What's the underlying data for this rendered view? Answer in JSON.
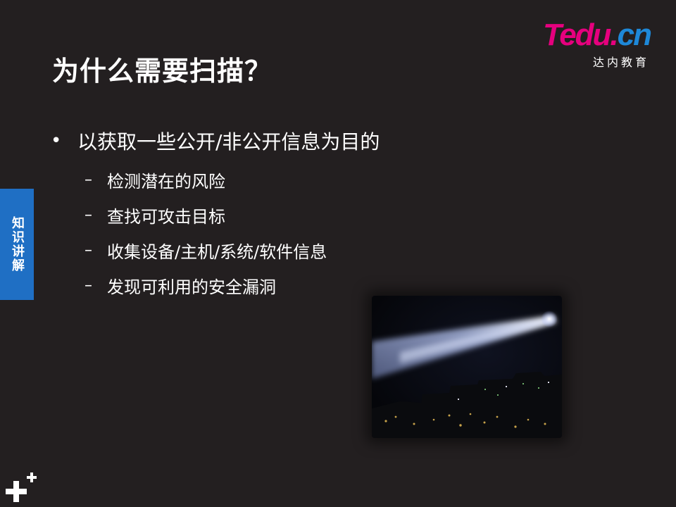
{
  "logo": {
    "brand_t": "T",
    "brand_rest": "edu.",
    "brand_cn": "cn",
    "subtitle": "达内教育",
    "colors": {
      "magenta": "#e6007e",
      "blue": "#1e88d8"
    }
  },
  "title": "为什么需要扫描？",
  "side_tab": {
    "label": "知识讲解",
    "color": "#1f6fc4"
  },
  "bullets": [
    {
      "text": "以获取一些公开/非公开信息为目的",
      "sub_items": [
        "检测潜在的风险",
        "查找可攻击目标",
        "收集设备/主机/系统/软件信息",
        "发现可利用的安全漏洞"
      ]
    }
  ],
  "bullet_symbol": "•",
  "sub_bullet_symbol": "–",
  "photo": {
    "subject": "searchlight-beam-night-sky"
  },
  "plus_mark": {
    "icon": "plus-icon"
  },
  "colors": {
    "background": "#231f20",
    "text": "#ffffff"
  }
}
